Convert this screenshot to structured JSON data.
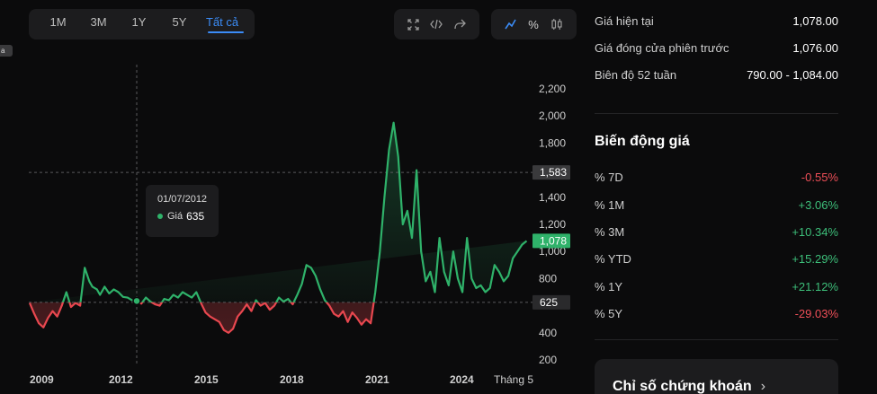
{
  "range_tabs": [
    {
      "label": "1M",
      "active": false
    },
    {
      "label": "3M",
      "active": false
    },
    {
      "label": "1Y",
      "active": false
    },
    {
      "label": "5Y",
      "active": false
    },
    {
      "label": "Tất cả",
      "active": true
    }
  ],
  "tools": {
    "share_group": [
      "fullscreen-icon",
      "embed-code-icon",
      "share-icon"
    ],
    "view_group": [
      "line-chart-icon",
      "percent-icon",
      "candlestick-icon"
    ],
    "percent_label": "%"
  },
  "left_tag": "a",
  "tooltip": {
    "date": "01/07/2012",
    "label": "Giá",
    "value": "635"
  },
  "chart_data": {
    "type": "line",
    "title": "",
    "xlabel": "",
    "ylabel": "",
    "x_ticks": [
      "2009",
      "2012",
      "2015",
      "2018",
      "2021",
      "2024",
      "Tháng 5"
    ],
    "y_ticks": [
      200,
      400,
      600,
      800,
      1000,
      1200,
      1400,
      1600,
      1800,
      2000,
      2200
    ],
    "ylim": [
      100,
      2300
    ],
    "xlim": [
      2008.9,
      2025.4
    ],
    "reference_price": 625,
    "reference_label": "625",
    "crosshair_label": "1,583",
    "crosshair_value": 1583,
    "last_price_label": "1,078",
    "last_price": 1078,
    "hover_point": {
      "x": 2012.5,
      "y": 635
    },
    "colors": {
      "above": "#2fb26a",
      "below": "#e8474f"
    },
    "x": [
      2009.0,
      2009.15,
      2009.3,
      2009.45,
      2009.6,
      2009.75,
      2009.9,
      2010.05,
      2010.2,
      2010.35,
      2010.5,
      2010.65,
      2010.8,
      2010.95,
      2011.05,
      2011.2,
      2011.3,
      2011.45,
      2011.6,
      2011.75,
      2011.9,
      2012.05,
      2012.2,
      2012.35,
      2012.5,
      2012.65,
      2012.8,
      2012.95,
      2013.1,
      2013.25,
      2013.4,
      2013.55,
      2013.7,
      2013.85,
      2014.0,
      2014.15,
      2014.3,
      2014.45,
      2014.6,
      2014.75,
      2014.9,
      2015.05,
      2015.2,
      2015.35,
      2015.5,
      2015.65,
      2015.8,
      2015.95,
      2016.1,
      2016.25,
      2016.4,
      2016.55,
      2016.7,
      2016.85,
      2017.0,
      2017.15,
      2017.3,
      2017.45,
      2017.6,
      2017.75,
      2017.9,
      2018.05,
      2018.2,
      2018.35,
      2018.5,
      2018.65,
      2018.8,
      2018.95,
      2019.1,
      2019.25,
      2019.4,
      2019.55,
      2019.7,
      2019.85,
      2020.0,
      2020.15,
      2020.3,
      2020.45,
      2020.6,
      2020.75,
      2020.9,
      2021.05,
      2021.2,
      2021.35,
      2021.5,
      2021.65,
      2021.8,
      2021.95,
      2022.1,
      2022.25,
      2022.4,
      2022.55,
      2022.7,
      2022.85,
      2023.0,
      2023.15,
      2023.3,
      2023.45,
      2023.6,
      2023.75,
      2023.9,
      2024.05,
      2024.2,
      2024.35,
      2024.5,
      2024.65,
      2024.8,
      2024.95,
      2025.1,
      2025.25,
      2025.4
    ],
    "y": [
      620,
      540,
      470,
      440,
      510,
      560,
      520,
      600,
      700,
      590,
      620,
      600,
      880,
      780,
      740,
      720,
      680,
      740,
      690,
      720,
      700,
      665,
      660,
      640,
      635,
      615,
      660,
      630,
      610,
      600,
      650,
      640,
      680,
      660,
      700,
      680,
      660,
      700,
      620,
      550,
      520,
      500,
      480,
      420,
      400,
      430,
      520,
      560,
      610,
      560,
      640,
      600,
      620,
      570,
      600,
      660,
      630,
      650,
      610,
      680,
      760,
      900,
      880,
      820,
      720,
      640,
      600,
      540,
      520,
      560,
      480,
      550,
      510,
      460,
      500,
      470,
      700,
      1000,
      1400,
      1750,
      1950,
      1700,
      1200,
      1300,
      1100,
      1600,
      1000,
      780,
      850,
      700,
      1100,
      850,
      750,
      1000,
      800,
      700,
      1100,
      800,
      730,
      750,
      700,
      730,
      900,
      850,
      780,
      820,
      950,
      1000,
      1050,
      1078
    ]
  },
  "summary": {
    "current_price_label": "Giá hiện tại",
    "current_price": "1,078.00",
    "prev_close_label": "Giá đóng cửa phiên trước",
    "prev_close": "1,076.00",
    "range52_label": "Biên độ 52 tuần",
    "range52": "790.00 - 1,084.00"
  },
  "performance": {
    "title": "Biến động giá",
    "items": [
      {
        "label": "% 7D",
        "value": "-0.55%",
        "trend": "neg"
      },
      {
        "label": "% 1M",
        "value": "+3.06%",
        "trend": "pos"
      },
      {
        "label": "% 3M",
        "value": "+10.34%",
        "trend": "pos"
      },
      {
        "label": "% YTD",
        "value": "+15.29%",
        "trend": "pos"
      },
      {
        "label": "% 1Y",
        "value": "+21.12%",
        "trend": "pos"
      },
      {
        "label": "% 5Y",
        "value": "-29.03%",
        "trend": "neg"
      }
    ]
  },
  "card": {
    "title": "Chỉ số chứng khoán",
    "chevron": "›"
  }
}
